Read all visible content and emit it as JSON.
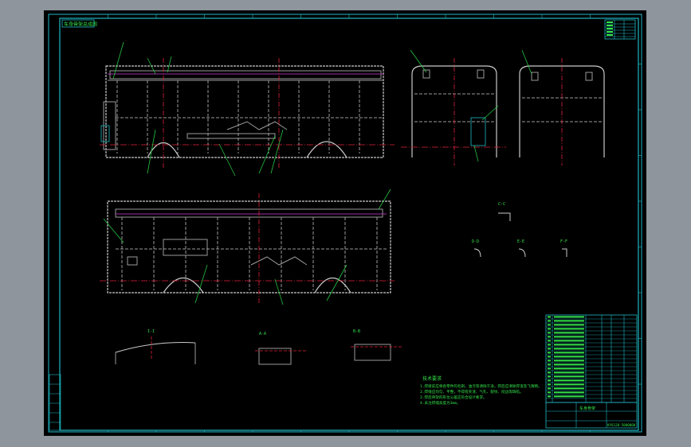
{
  "drawing": {
    "title_block_tag": "车身骨架总成图",
    "notes_heading": "技术要求",
    "notes_lines": [
      "1.焊接前应将各零件的毛刺、油污等清除干净，焊后应清除焊渣及飞溅物。",
      "2.焊缝应均匀、平整，不得有夹渣、气孔、裂纹、咬边等缺陷。",
      "3.焊后骨架的形位公差应符合设计要求。",
      "4.未注焊缝高度为3mm。"
    ],
    "title_name": "车身骨架",
    "title_code": "KY6120-5000000",
    "section_labels": [
      "I-I",
      "A-A",
      "B-B",
      "C-C",
      "D-D",
      "E-E",
      "F-F"
    ]
  },
  "colors": {
    "background": "#000000",
    "frame": "#c9c9c9",
    "border": "#1fb8c4",
    "text": "#34e34a",
    "centerline": "#e0203a",
    "accent": "#d03ad9"
  }
}
